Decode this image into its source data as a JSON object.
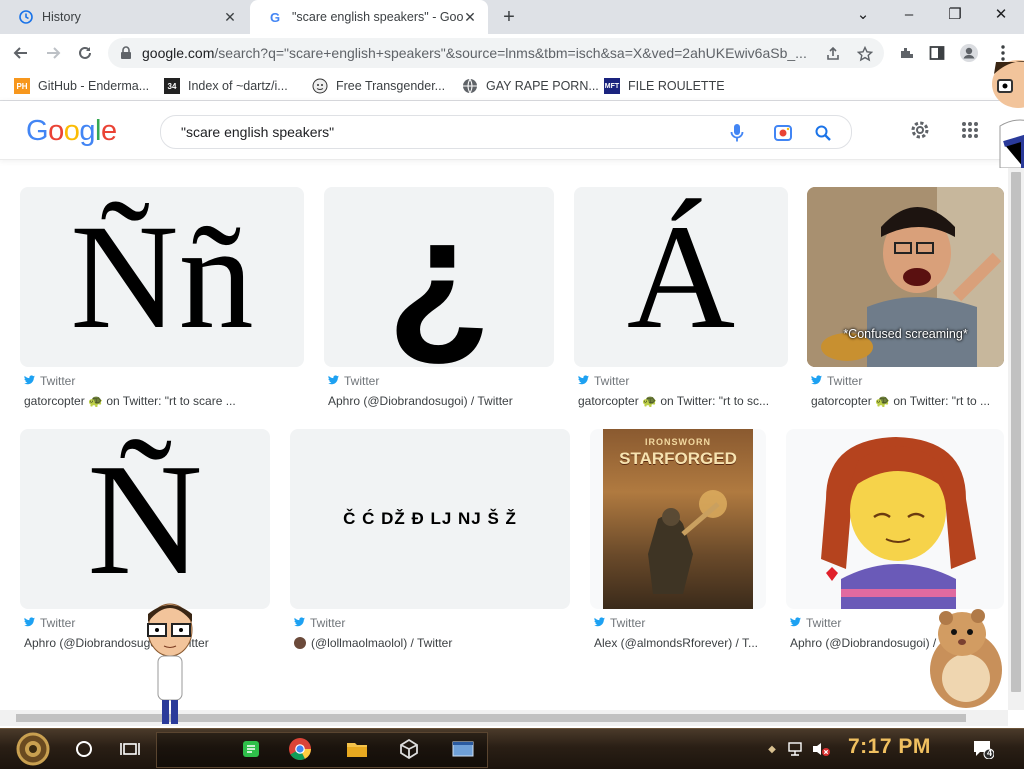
{
  "browser": {
    "tabs": [
      {
        "title": "History",
        "active": false
      },
      {
        "title": "\"scare english speakers\" - Google",
        "active": true
      }
    ],
    "url_host": "google.com",
    "url_rest": "/search?q=\"scare+english+speakers\"&source=lnms&tbm=isch&sa=X&ved=2ahUKEwiv6aSb_...",
    "bookmarks": [
      {
        "label": "GitHub - Enderma...",
        "icon": "PH"
      },
      {
        "label": "Index of ~dartz/i...",
        "icon": "34"
      },
      {
        "label": "Free Transgender...",
        "icon": "avatar"
      },
      {
        "label": "GAY RAPE PORN...",
        "icon": "globe"
      },
      {
        "label": "FILE ROULETTE",
        "icon": "MFT"
      }
    ]
  },
  "google": {
    "logo": [
      "G",
      "o",
      "o",
      "g",
      "l",
      "e"
    ],
    "logo_colors": [
      "#4285F4",
      "#EA4335",
      "#FBBC05",
      "#4285F4",
      "#34A853",
      "#EA4335"
    ],
    "query": "\"scare english speakers\""
  },
  "results": [
    {
      "glyph": "Ññ",
      "source": "Twitter",
      "caption": "gatorcopter 🐢 on Twitter: \"rt to scare ..."
    },
    {
      "glyph": "¿",
      "source": "Twitter",
      "caption": "Aphro (@Diobrandosugoi) / Twitter"
    },
    {
      "glyph": "Á",
      "source": "Twitter",
      "caption": "gatorcopter 🐢 on Twitter: \"rt to sc..."
    },
    {
      "image_text": "*Confused screaming*",
      "source": "Twitter",
      "caption": "gatorcopter 🐢 on Twitter: \"rt to ..."
    },
    {
      "glyph": "Ñ",
      "source": "Twitter",
      "caption": "Aphro (@Diobrandosugoi) / Twitter"
    },
    {
      "glyph": "Č Ć DŽ Đ LJ NJ Š Ž",
      "source": "Twitter",
      "caption": "(@lollmaolmaolol) / Twitter"
    },
    {
      "image_text": [
        "IRONSWORN",
        "STARFORGED"
      ],
      "source": "Twitter",
      "caption": "Alex (@almondsRforever) / T..."
    },
    {
      "image_text": "",
      "source": "Twitter",
      "caption": "Aphro (@Diobrandosugoi) / Twitter"
    }
  ],
  "taskbar": {
    "time": "7:17 PM",
    "notification_count": "4"
  },
  "colors": {
    "twitter": "#1DA1F2",
    "google_blue": "#4285F4",
    "clock": "#f0c060"
  }
}
